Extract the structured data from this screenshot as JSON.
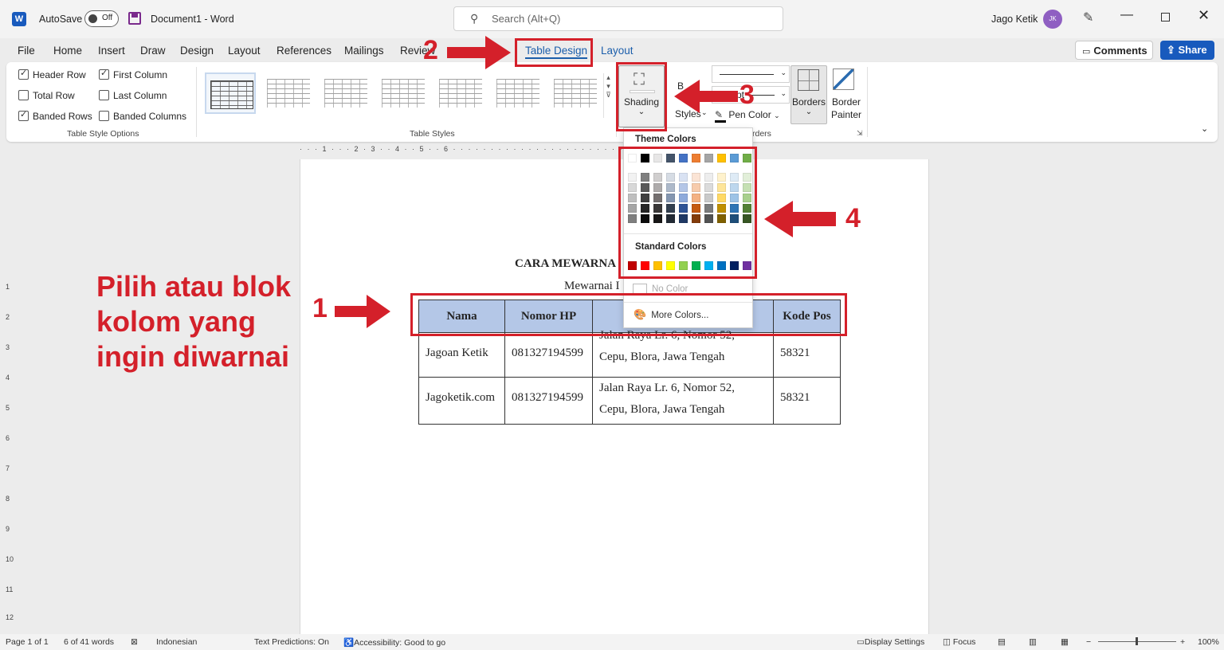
{
  "titlebar": {
    "app_icon": "W",
    "autosave_label": "AutoSave",
    "autosave_state": "Off",
    "doc_title": "Document1  -  Word",
    "search_placeholder": "Search (Alt+Q)",
    "user_name": "Jago Ketik",
    "user_initials": "JK"
  },
  "menu": {
    "tabs": [
      "File",
      "Home",
      "Insert",
      "Draw",
      "Design",
      "Layout",
      "References",
      "Mailings",
      "Review",
      "Table Design",
      "Layout"
    ],
    "active_tab": "Table Design",
    "comments_label": "Comments",
    "share_label": "Share"
  },
  "ribbon": {
    "style_options": {
      "header_row": "Header Row",
      "header_row_checked": true,
      "first_column": "First Column",
      "first_column_checked": true,
      "total_row": "Total Row",
      "total_row_checked": false,
      "last_column": "Last Column",
      "last_column_checked": false,
      "banded_rows": "Banded Rows",
      "banded_rows_checked": true,
      "banded_columns": "Banded Columns",
      "banded_columns_checked": false,
      "group_label": "Table Style Options"
    },
    "table_styles_label": "Table Styles",
    "shading_label": "Shading",
    "border_styles_label": "Styles",
    "border_styles_prefix": "B",
    "weight_value": "pt",
    "pen_color_label": "Pen Color",
    "borders_label": "Borders",
    "border_painter_line1": "Border",
    "border_painter_line2": "Painter",
    "borders_group_label": "rders"
  },
  "ruler": {
    "text": "· · · 1 · · · 2 · 3 · · 4 · · 5 · · 6 · · · · · · · · · · · · · · · · · · · · · · · 12 · · 13 · · · · · · · · · · ·"
  },
  "vruler": [
    "1",
    "2",
    "3",
    "4",
    "5",
    "6",
    "7",
    "8",
    "9",
    "10",
    "11",
    "12"
  ],
  "document": {
    "heading": "CARA MEWARNA",
    "subheading": "Mewarnai I",
    "table": {
      "headers": [
        "Nama",
        "Nomor HP",
        "",
        "Kode Pos"
      ],
      "rows": [
        {
          "c1": "Jagoan Ketik",
          "c2": "081327194599",
          "c3a": "Jalan Raya Lr. 6, Nomor 52,",
          "c3b": "Cepu, Blora, Jawa Tengah",
          "c4": "58321"
        },
        {
          "c1": "Jagoketik.com",
          "c2": "081327194599",
          "c3a": "Jalan Raya Lr. 6, Nomor 52,",
          "c3b": "Cepu, Blora, Jawa Tengah",
          "c4": "58321"
        }
      ]
    }
  },
  "shading_dropdown": {
    "theme_colors_label": "Theme Colors",
    "standard_colors_label": "Standard Colors",
    "no_color_label": "No Color",
    "more_colors_label": "More Colors...",
    "theme_top": [
      "#ffffff",
      "#000000",
      "#e7e6e6",
      "#44546a",
      "#4472c4",
      "#ed7d31",
      "#a5a5a5",
      "#ffc000",
      "#5b9bd5",
      "#70ad47"
    ],
    "theme_shades": [
      [
        "#f2f2f2",
        "#7f7f7f",
        "#d0cece",
        "#d6dce4",
        "#d9e2f3",
        "#fbe4d5",
        "#ededed",
        "#fff2cc",
        "#deebf6",
        "#e2efd9"
      ],
      [
        "#d8d8d8",
        "#595959",
        "#aeabab",
        "#adb9ca",
        "#b4c6e7",
        "#f7cbac",
        "#dbdbdb",
        "#fee599",
        "#bdd7ee",
        "#c5e0b3"
      ],
      [
        "#bfbfbf",
        "#3f3f3f",
        "#757070",
        "#8496b0",
        "#8eaadb",
        "#f4b183",
        "#c9c9c9",
        "#ffd965",
        "#9dc3e6",
        "#a8d08d"
      ],
      [
        "#a5a5a5",
        "#262626",
        "#3a3838",
        "#323f4f",
        "#2f5496",
        "#c55a11",
        "#7b7b7b",
        "#bf8f00",
        "#2e75b5",
        "#538135"
      ],
      [
        "#7f7f7f",
        "#0c0c0c",
        "#171616",
        "#222a35",
        "#1f3864",
        "#833c0b",
        "#525252",
        "#7f6000",
        "#1e4e79",
        "#375623"
      ]
    ],
    "standard": [
      "#c00000",
      "#ff0000",
      "#ffc000",
      "#ffff00",
      "#92d050",
      "#00b050",
      "#00b0f0",
      "#0070c0",
      "#002060",
      "#7030a0"
    ]
  },
  "annotations": {
    "instruction_text": "Pilih atau blok\nkolom yang\ningin diwarnai",
    "step1": "1",
    "step2": "2",
    "step3": "3",
    "step4": "4",
    "accent_color": "#d4202a"
  },
  "statusbar": {
    "page": "Page 1 of 1",
    "words": "6 of 41 words",
    "language": "Indonesian",
    "predictions": "Text Predictions: On",
    "accessibility": "Accessibility: Good to go",
    "display_settings": "Display Settings",
    "focus": "Focus",
    "zoom": "100%"
  }
}
